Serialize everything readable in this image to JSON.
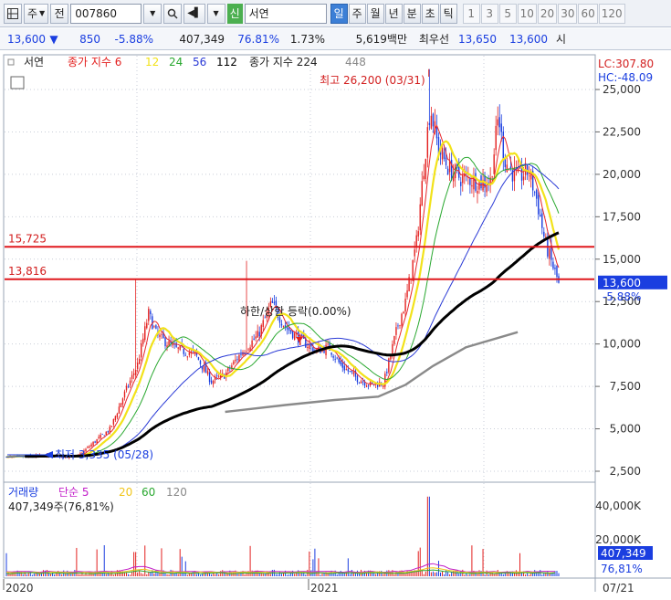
{
  "toolbar": {
    "chart_icon": "chart-grid-icon",
    "market_label": "주",
    "stock_type_label": "전",
    "code_value": "007860",
    "search_icon": "magnifier-icon",
    "sound_icon": "speaker-icon",
    "credit_tag": "신",
    "name_value": "서연",
    "periods": [
      "일",
      "주",
      "월",
      "년",
      "분",
      "초",
      "틱"
    ],
    "active_period": "일",
    "intervals": [
      "1",
      "3",
      "5",
      "10",
      "20",
      "30",
      "60",
      "120"
    ]
  },
  "quote": {
    "price": "13,600",
    "direction": "▼",
    "change": "850",
    "change_pct": "-5.88%",
    "volume": "407,349",
    "volume_ratio": "76.81%",
    "turnover": "1.73%",
    "amount": "5,619백만",
    "best_label": "최우선",
    "ask": "13,650",
    "bid": "13,600",
    "tail": "시"
  },
  "chart_data": [
    {
      "type": "candlestick",
      "name": "서연",
      "legend": {
        "stock_name": "서연",
        "price_ma_label": "종가 지수",
        "ma_periods": [
          "6",
          "12",
          "24",
          "56",
          "112"
        ],
        "long_ma_label": "종가 지수 224",
        "long_ma_extra": "448"
      },
      "ma_colors": {
        "6": "#e8262b",
        "12": "#f2e21a",
        "24": "#2aa830",
        "56": "#2a3ad6",
        "112": "#000000",
        "224": "#8a8a8a"
      },
      "y_axis": {
        "min": 2500,
        "max": 26200,
        "ticks": [
          2500,
          5000,
          7500,
          10000,
          12500,
          15000,
          17500,
          20000,
          22500,
          25000
        ],
        "tick_labels": [
          "2,500",
          "5,000",
          "7,500",
          "10,000",
          "12,500",
          "15,000",
          "17,500",
          "20,000",
          "22,500",
          "25,000"
        ]
      },
      "x_axis": {
        "labels": [
          "2020",
          "2021",
          "07/21"
        ]
      },
      "lc_label": "LC:307.80",
      "hc_label": "HC:-48.09",
      "last_price_label": "13,600",
      "last_change_label": "-5.88%",
      "horizontal_lines": [
        {
          "value": 15725,
          "label": "15,725"
        },
        {
          "value": 13816,
          "label": "13,816"
        }
      ],
      "high_annotation": "최고 26,200 (03/31)",
      "low_annotation": "최저 3,335 (05/28)",
      "limit_annotation": "하한/상한 등락(0.00%)",
      "series": [
        {
          "name": "종가",
          "x": [
            "2020-01",
            "2020-03",
            "2020-05",
            "2020-06",
            "2020-07",
            "2020-08",
            "2020-09",
            "2020-10",
            "2020-11",
            "2020-12",
            "2021-01",
            "2021-02",
            "2021-03",
            "2021-04",
            "2021-05",
            "2021-06",
            "2021-07"
          ],
          "values": [
            3300,
            3500,
            3400,
            7500,
            11000,
            9500,
            8500,
            11500,
            10000,
            9000,
            7500,
            12000,
            23500,
            19500,
            19000,
            20000,
            13600
          ]
        },
        {
          "name": "224",
          "x": [
            "2020-01",
            "2020-06",
            "2020-10",
            "2021-01",
            "2021-04",
            "2021-07"
          ],
          "values": [
            3300,
            4800,
            7500,
            7700,
            11000,
            13600
          ]
        }
      ]
    },
    {
      "type": "bar",
      "name": "거래량",
      "legend": {
        "volume_label": "거래량",
        "ma_label": "단순",
        "ma_periods": [
          "5",
          "20",
          "60",
          "120"
        ],
        "current_label": "407,349주(76,81%)"
      },
      "y_axis": {
        "tick_labels": [
          "40,000K",
          "20,000K"
        ]
      },
      "last_volume_label": "407,349",
      "last_ratio_label": "76,81%"
    }
  ]
}
